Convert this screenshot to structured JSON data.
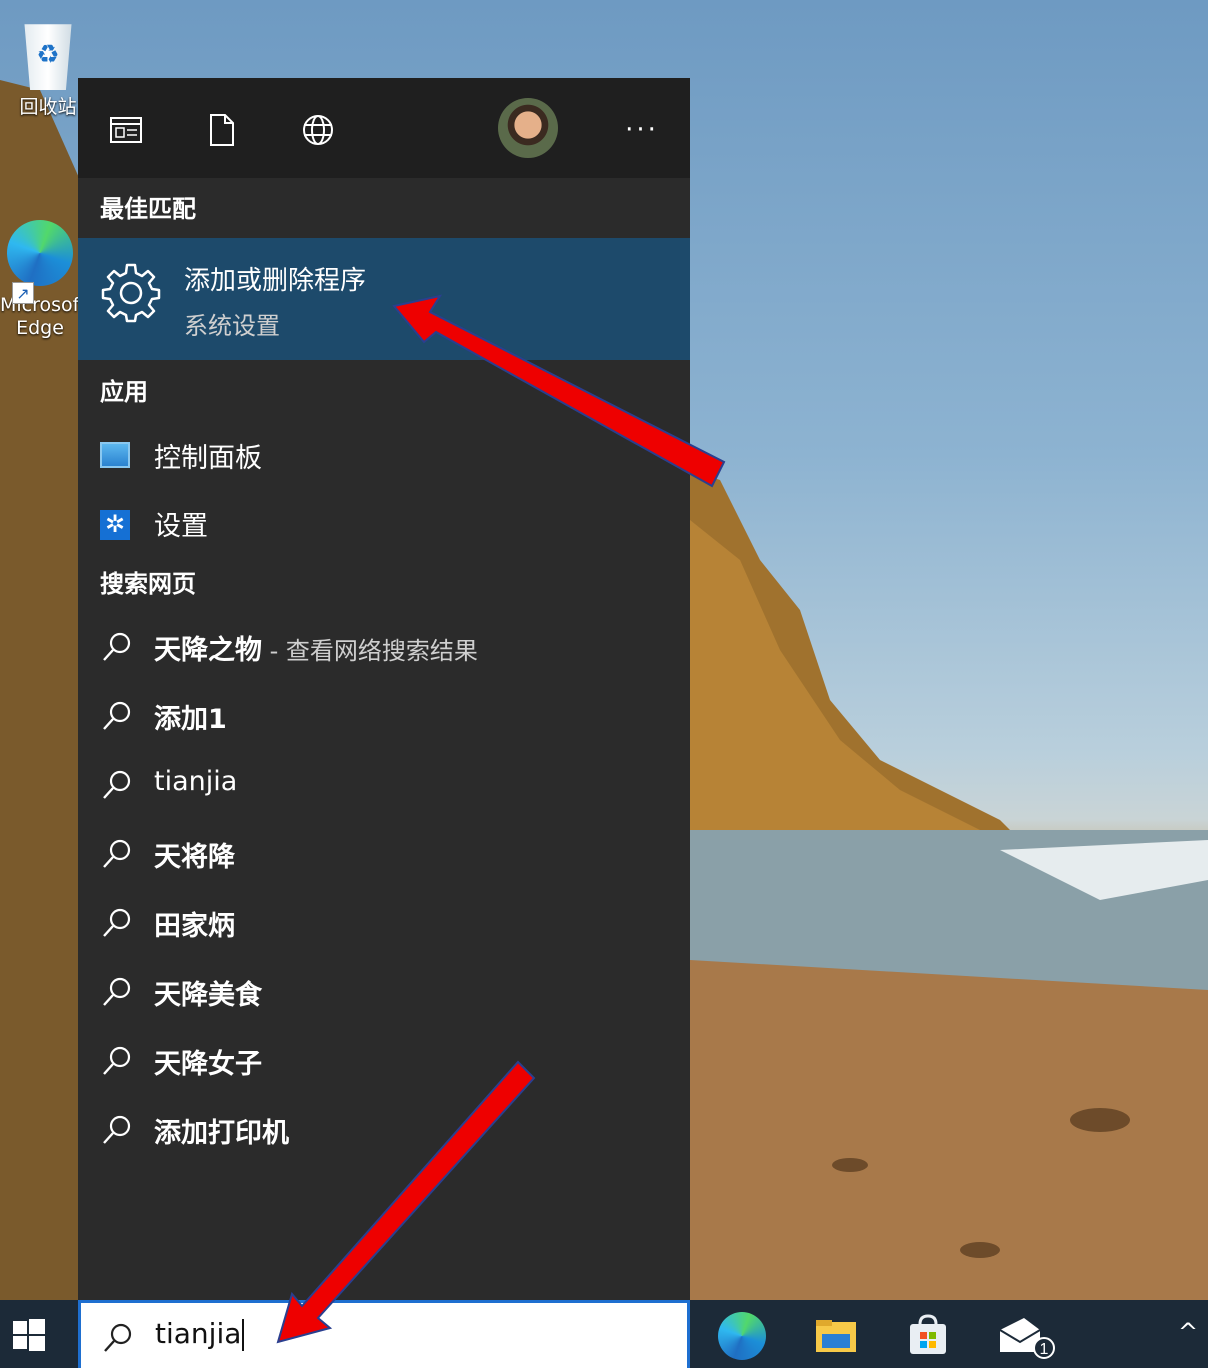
{
  "desktop": {
    "icons": [
      {
        "label": "回收站",
        "icon": "recycle-bin-icon"
      },
      {
        "label": "Microsoft Edge",
        "icon": "edge-icon"
      }
    ]
  },
  "panel": {
    "toolbar": {
      "apps_icon": "apps-icon",
      "documents_icon": "document-icon",
      "web_icon": "globe-icon",
      "avatar_icon": "user-avatar",
      "more_label": "···"
    },
    "best_match": {
      "heading": "最佳匹配",
      "title": "添加或删除程序",
      "subtitle": "系统设置",
      "icon": "gear-icon"
    },
    "apps": {
      "heading": "应用",
      "items": [
        {
          "label": "控制面板",
          "icon": "control-panel-icon"
        },
        {
          "label": "设置",
          "icon": "settings-icon"
        }
      ]
    },
    "web": {
      "heading": "搜索网页",
      "items": [
        {
          "label": "天降之物",
          "hint": " - 查看网络搜索结果"
        },
        {
          "label": "添加1"
        },
        {
          "label": "tianjia"
        },
        {
          "label": "天将降"
        },
        {
          "label": "田家炳"
        },
        {
          "label": "天降美食"
        },
        {
          "label": "天降女子"
        },
        {
          "label": "添加打印机"
        }
      ]
    }
  },
  "taskbar": {
    "search_value": "tianjia",
    "apps": [
      "edge-icon",
      "file-explorer-icon",
      "store-icon",
      "mail-icon"
    ],
    "mail_badge": "1",
    "chevron": "^"
  },
  "colors": {
    "panel_bg": "#2b2b2b",
    "panel_top_bg": "#1f1f1f",
    "highlight": "#1d4a6b",
    "taskbar_bg": "#1c2a38",
    "annotation_arrow": "#ee0000"
  }
}
